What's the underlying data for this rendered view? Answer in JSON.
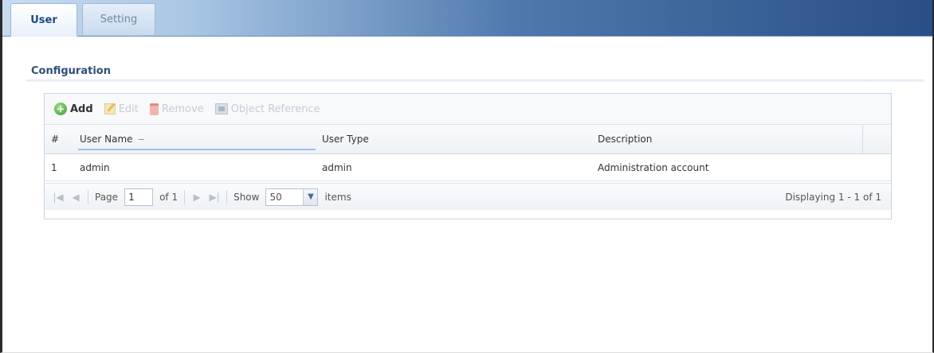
{
  "tabs": [
    {
      "label": "User"
    },
    {
      "label": "Setting"
    }
  ],
  "section": {
    "title": "Configuration"
  },
  "toolbar": {
    "add_label": "Add",
    "edit_label": "Edit",
    "remove_label": "Remove",
    "object_ref_label": "Object Reference"
  },
  "table": {
    "columns": [
      "#",
      "User Name",
      "User Type",
      "Description"
    ],
    "sort_indicator": "−",
    "rows": [
      {
        "num": "1",
        "user_name": "admin",
        "user_type": "admin",
        "description": "Administration account"
      }
    ]
  },
  "pager": {
    "page_label": "Page",
    "page_value": "1",
    "of_label": "of 1",
    "show_label": "Show",
    "show_value": "50",
    "items_label": "items",
    "displaying": "Displaying 1 - 1 of 1"
  },
  "colors": {
    "tab_gradient_dark": "#284f86",
    "section_title": "#2e4f78",
    "add_icon": "#3a9a2a"
  },
  "icons": {
    "add": "plus-circle-icon",
    "edit": "pencil-icon",
    "remove": "trash-icon",
    "object_ref": "object-reference-icon"
  }
}
